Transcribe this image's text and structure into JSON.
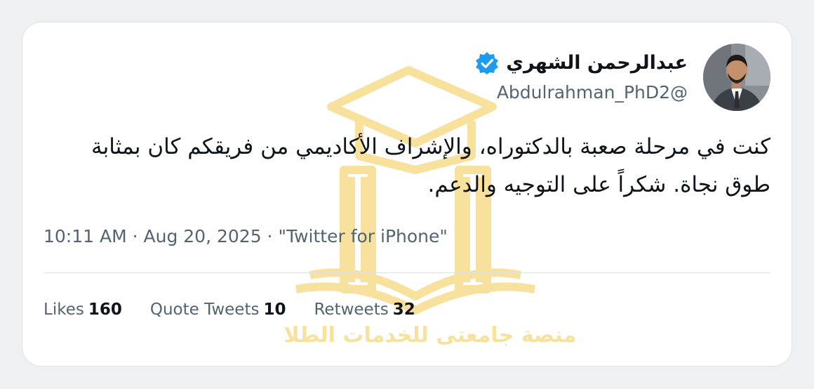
{
  "tweet": {
    "author_name": "عبدالرحمن الشهري",
    "author_handle": "Abdulrahman_PhD2@",
    "text": "كنت في مرحلة صعبة بالدكتوراه، والإشراف الأكاديمي من فريقكم كان بمثابة طوق نجاة. شكراً على التوجيه والدعم.",
    "time": "10:11 AM",
    "date": "Aug 20, 2025",
    "source": "\"Twitter for iPhone\"",
    "separator": " · "
  },
  "stats": {
    "likes_label": "Likes",
    "likes_count": "160",
    "quotes_label": "Quote Tweets",
    "quotes_count": "10",
    "retweets_label": "Retweets",
    "retweets_count": "32"
  },
  "watermark": {
    "text": "منصة جامعتي للخدمات الطلابية"
  },
  "colors": {
    "verified_blue": "#1d9bf0",
    "watermark_gold": "#f2c94c",
    "text_primary": "#0f1419",
    "text_secondary": "#536471"
  },
  "icons": {
    "verified": "verified-badge-icon",
    "watermark_logo": "graduation-cap-book-logo"
  }
}
